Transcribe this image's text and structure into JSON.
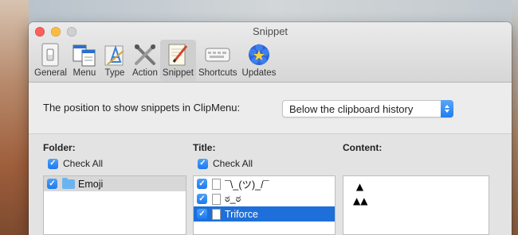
{
  "window": {
    "title": "Snippet"
  },
  "toolbar": {
    "items": [
      {
        "label": "General",
        "icon": "general-switch-icon",
        "active": false
      },
      {
        "label": "Menu",
        "icon": "menu-windows-icon",
        "active": false
      },
      {
        "label": "Type",
        "icon": "type-pen-icon",
        "active": false
      },
      {
        "label": "Action",
        "icon": "action-tools-icon",
        "active": false
      },
      {
        "label": "Snippet",
        "icon": "snippet-notepad-icon",
        "active": true
      },
      {
        "label": "Shortcuts",
        "icon": "keyboard-icon",
        "active": false
      },
      {
        "label": "Updates",
        "icon": "updates-sparkle-icon",
        "active": false
      }
    ]
  },
  "position": {
    "label": "The position to show snippets in ClipMenu:",
    "selected": "Below the clipboard history"
  },
  "folder": {
    "header": "Folder:",
    "check_all": "Check All",
    "items": [
      {
        "label": "Emoji",
        "checked": true
      }
    ]
  },
  "title": {
    "header": "Title:",
    "check_all": "Check All",
    "items": [
      {
        "label": "¯\\_(ツ)_/¯",
        "checked": true
      },
      {
        "label": "ಠ_ಠ",
        "checked": true
      },
      {
        "label": "Triforce",
        "checked": true
      }
    ]
  },
  "content": {
    "header": "Content:",
    "text": " ▲\n▲▲"
  },
  "colors": {
    "accent": "#1e6fd9",
    "close": "#fc605b",
    "minimize": "#fdbc40"
  }
}
